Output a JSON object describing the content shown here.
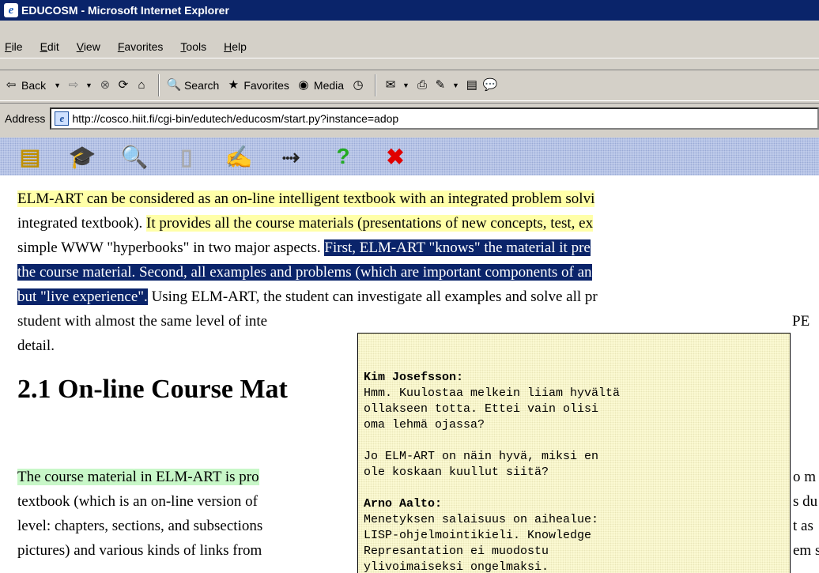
{
  "window": {
    "title": "EDUCOSM - Microsoft Internet Explorer"
  },
  "menu": [
    "File",
    "Edit",
    "View",
    "Favorites",
    "Tools",
    "Help"
  ],
  "toolbar": {
    "back": "Back",
    "search": "Search",
    "favorites": "Favorites",
    "media": "Media"
  },
  "address": {
    "label": "Address",
    "url": "http://cosco.hiit.fi/cgi-bin/edutech/educosm/start.py?instance=adop"
  },
  "app_toolbar_icons": [
    "notes-icon",
    "graduation-cap-icon",
    "page-search-icon",
    "page-icon",
    "annotate-icon",
    "link-icon",
    "help-icon",
    "close-icon"
  ],
  "article": {
    "lines": [
      {
        "parts": [
          {
            "t": "ELM-ART can be considered as an on-line intelligent textbook with an integrated problem solvi",
            "hl": "y"
          }
        ]
      },
      {
        "parts": [
          {
            "t": "integrated textbook). ",
            "hl": ""
          },
          {
            "t": "It provides all the course materials (presentations of new concepts, test, ex",
            "hl": "y"
          }
        ]
      },
      {
        "parts": [
          {
            "t": "simple WWW \"hyperbooks\" in two major aspects. ",
            "hl": ""
          },
          {
            "t": "First, ELM-ART \"knows\" the material it pre",
            "hl": "b"
          }
        ]
      },
      {
        "parts": [
          {
            "t": "the course material. Second, all examples and problems (which are important components of an",
            "hl": "b"
          }
        ]
      },
      {
        "parts": [
          {
            "t": "but \"live experience\".",
            "hl": "b"
          },
          {
            "t": " Using ELM-ART, the student can investigate all examples and solve all pr",
            "hl": ""
          }
        ]
      },
      {
        "parts": [
          {
            "t": "student with almost the same level of inte",
            "hl": ""
          }
        ]
      },
      {
        "parts": [
          {
            "t": "detail.",
            "hl": ""
          }
        ]
      }
    ],
    "line6_tail": "PE",
    "heading": "2.1 On-line Course Mat",
    "lines2": [
      {
        "parts": [
          {
            "t": "The course material in ELM-ART is pro",
            "hl": "g"
          }
        ]
      },
      {
        "parts": [
          {
            "t": "textbook (which is an on-line version of",
            "hl": ""
          }
        ]
      },
      {
        "parts": [
          {
            "t": "level: chapters, sections, and subsections",
            "hl": ""
          }
        ]
      },
      {
        "parts": [
          {
            "t": "pictures) and various kinds of links from",
            "hl": ""
          }
        ]
      }
    ],
    "right_tails": [
      "o m",
      "s du",
      "t as",
      "em s"
    ]
  },
  "comments": [
    {
      "author": "Kim Josefsson:",
      "text": "Hmm. Kuulostaa melkein liiam hyvältä\nollakseen totta. Ettei vain olisi\noma lehmä ojassa?"
    },
    {
      "author": "",
      "text": "Jo ELM-ART on näin hyvä, miksi en\nole koskaan kuullut siitä?"
    },
    {
      "author": "Arno Aalto:",
      "text": "Menetyksen salaisuus on aihealue:\nLISP-ohjelmointikieli. Knowledge\nRepresantation ei muodostu\nylivoimaiseksi ongelmaksi."
    }
  ]
}
